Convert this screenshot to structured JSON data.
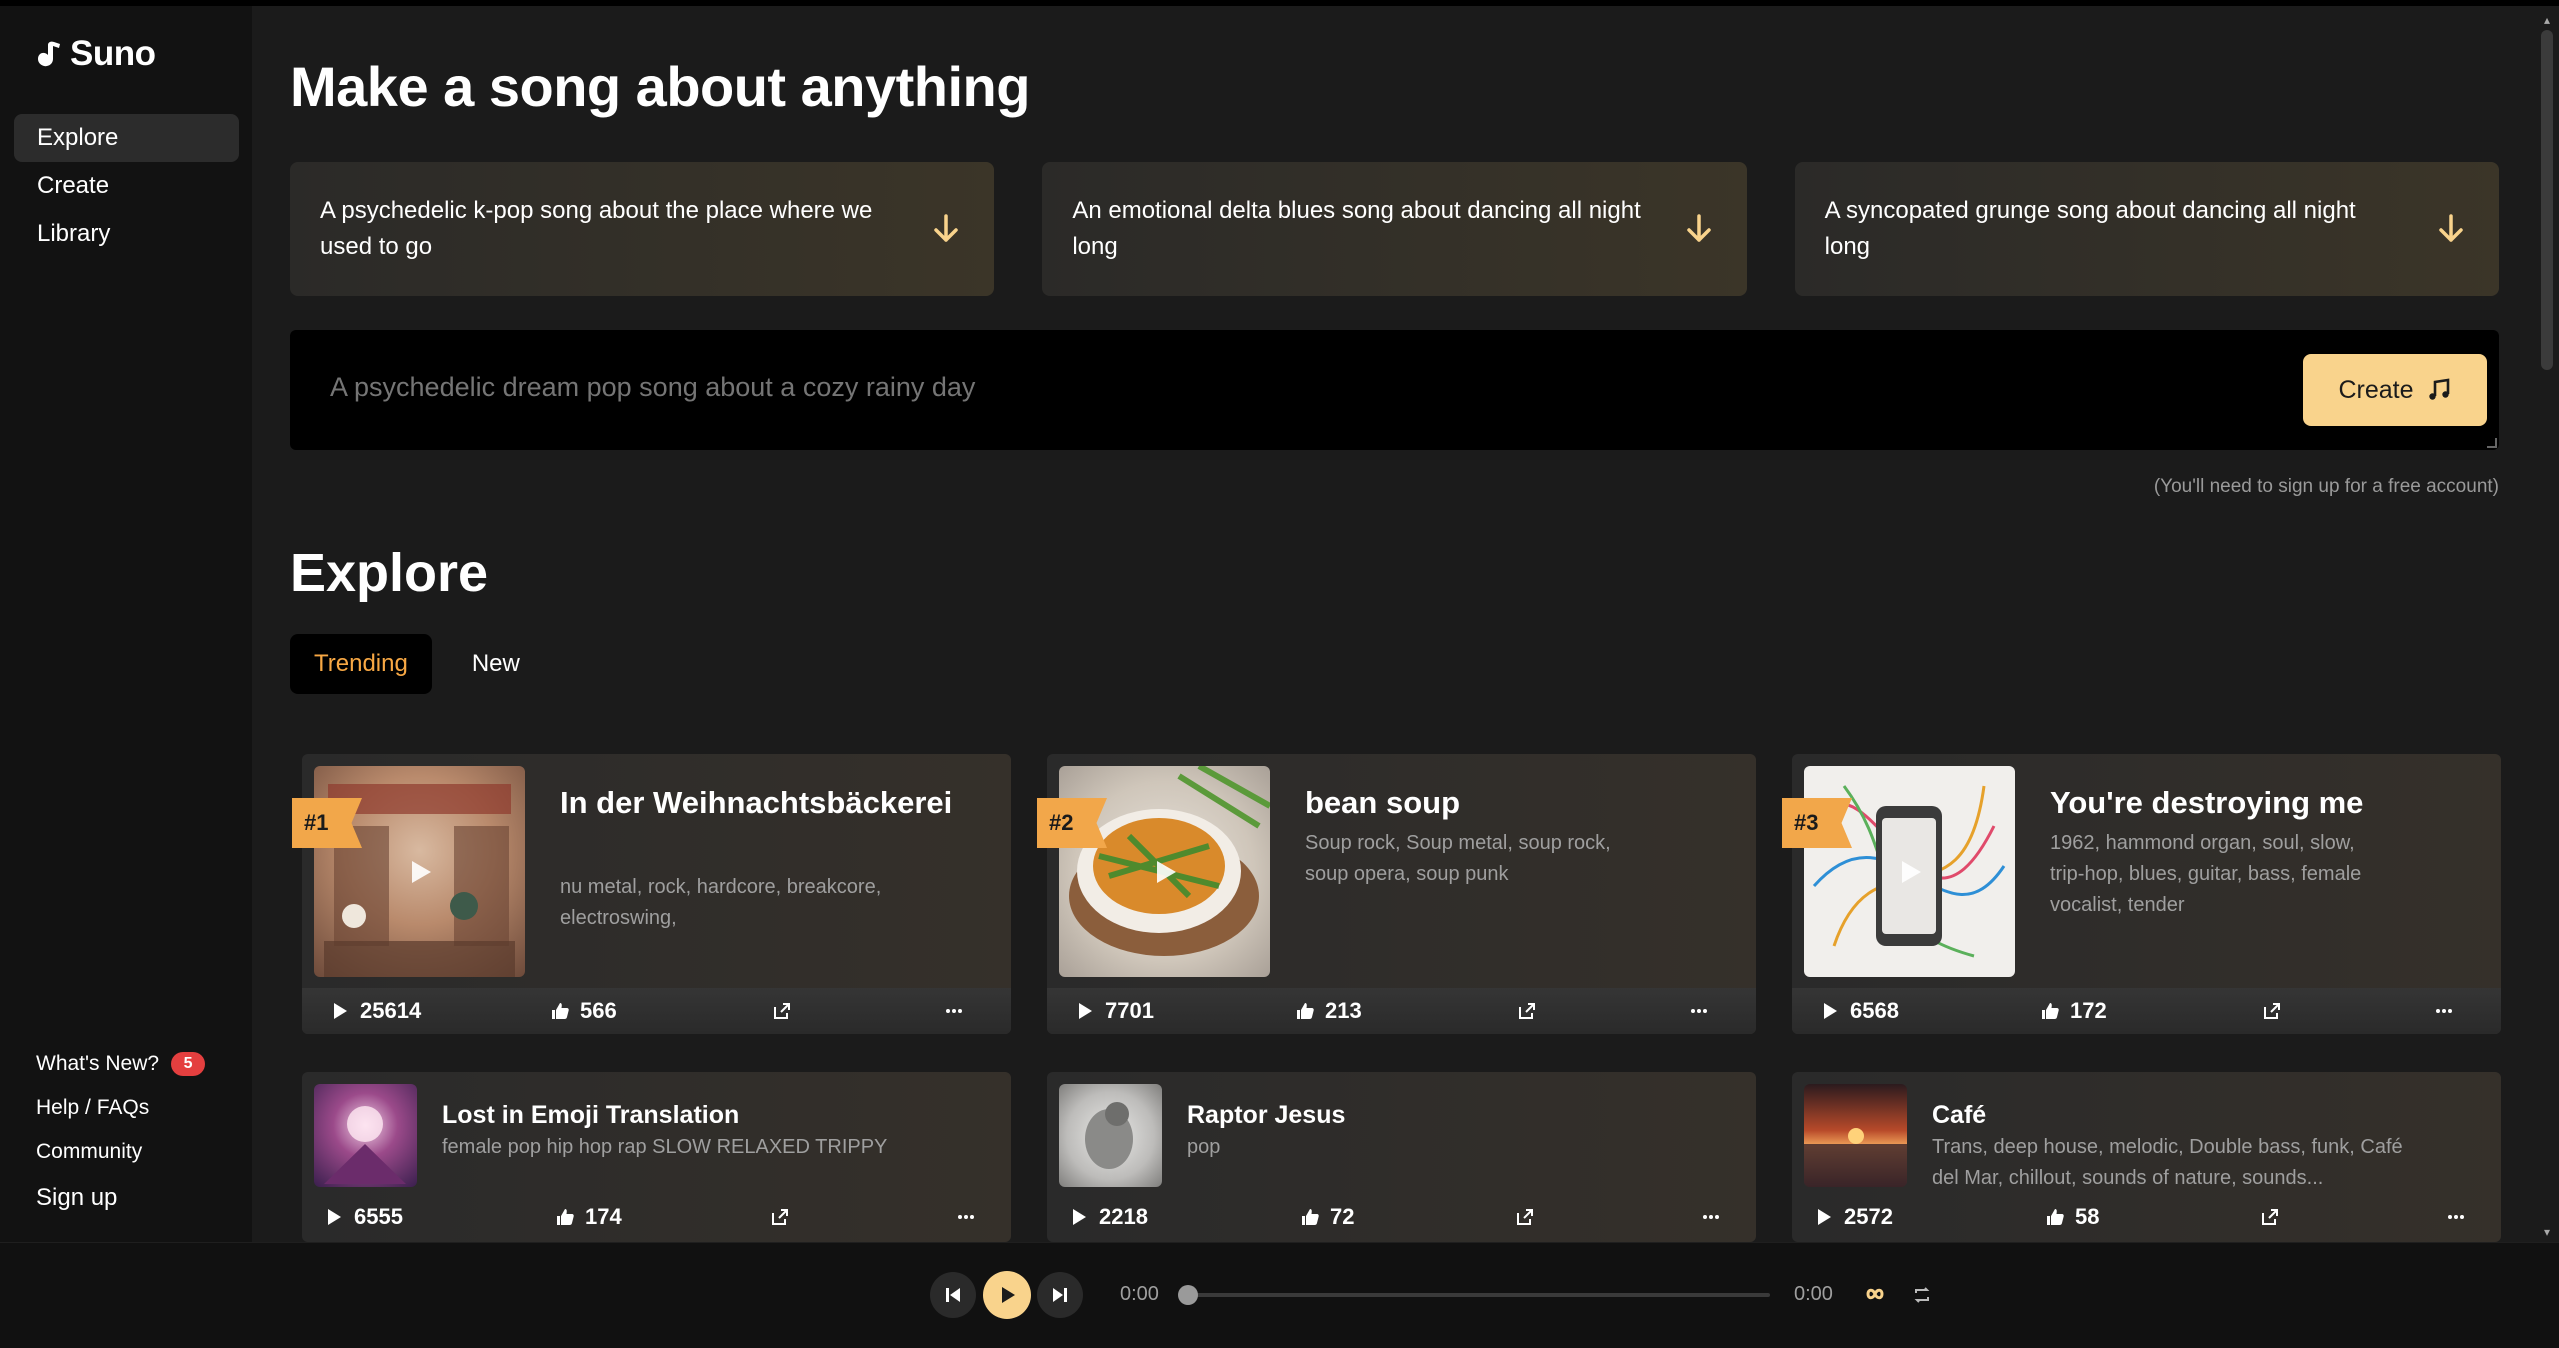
{
  "app": {
    "name": "Suno"
  },
  "sidebar": {
    "items": [
      {
        "label": "Explore",
        "active": true
      },
      {
        "label": "Create"
      },
      {
        "label": "Library"
      }
    ],
    "bottom": {
      "whats_new": "What's New?",
      "whats_new_badge": "5",
      "help": "Help / FAQs",
      "community": "Community",
      "signup": "Sign up"
    }
  },
  "hero": {
    "title": "Make a song about anything",
    "prompts": [
      "A psychedelic k-pop song about the place where we used to go",
      "An emotional delta blues song about dancing all night long",
      "A syncopated grunge song about dancing all night long"
    ],
    "input_placeholder": "A psychedelic dream pop song about a cozy rainy day",
    "create_label": "Create",
    "signup_note": "(You'll need to sign up for a free account)"
  },
  "explore": {
    "title": "Explore",
    "tabs": [
      "Trending",
      "New"
    ],
    "active_tab": "Trending",
    "songs": [
      {
        "rank": "#1",
        "title": "In der Weihnachtsbäckerei",
        "tags": "nu metal, rock, hardcore, breakcore, electroswing,",
        "plays": "25614",
        "likes": "566"
      },
      {
        "rank": "#2",
        "title": "bean soup",
        "tags": "Soup rock, Soup metal, soup rock, soup opera, soup punk",
        "plays": "7701",
        "likes": "213"
      },
      {
        "rank": "#3",
        "title": "You're destroying me",
        "tags": "1962, hammond organ, soul, slow, trip-hop, blues, guitar, bass, female vocalist, tender",
        "plays": "6568",
        "likes": "172"
      },
      {
        "title": "Lost in Emoji Translation",
        "tags": "female pop hip hop rap SLOW RELAXED TRIPPY",
        "plays": "6555",
        "likes": "174"
      },
      {
        "title": "Raptor Jesus",
        "tags": "pop",
        "plays": "2218",
        "likes": "72"
      },
      {
        "title": "Café",
        "tags": "Trans, deep house, melodic, Double bass, funk, Café del Mar, chillout, sounds of nature, sounds...",
        "plays": "2572",
        "likes": "58"
      }
    ]
  },
  "player": {
    "current_time": "0:00",
    "total_time": "0:00",
    "progress": 0
  },
  "colors": {
    "accent": "#f9d38c",
    "tab_active": "#f8a844",
    "rank_tag": "#f2a74a",
    "badge": "#e43f3f"
  }
}
